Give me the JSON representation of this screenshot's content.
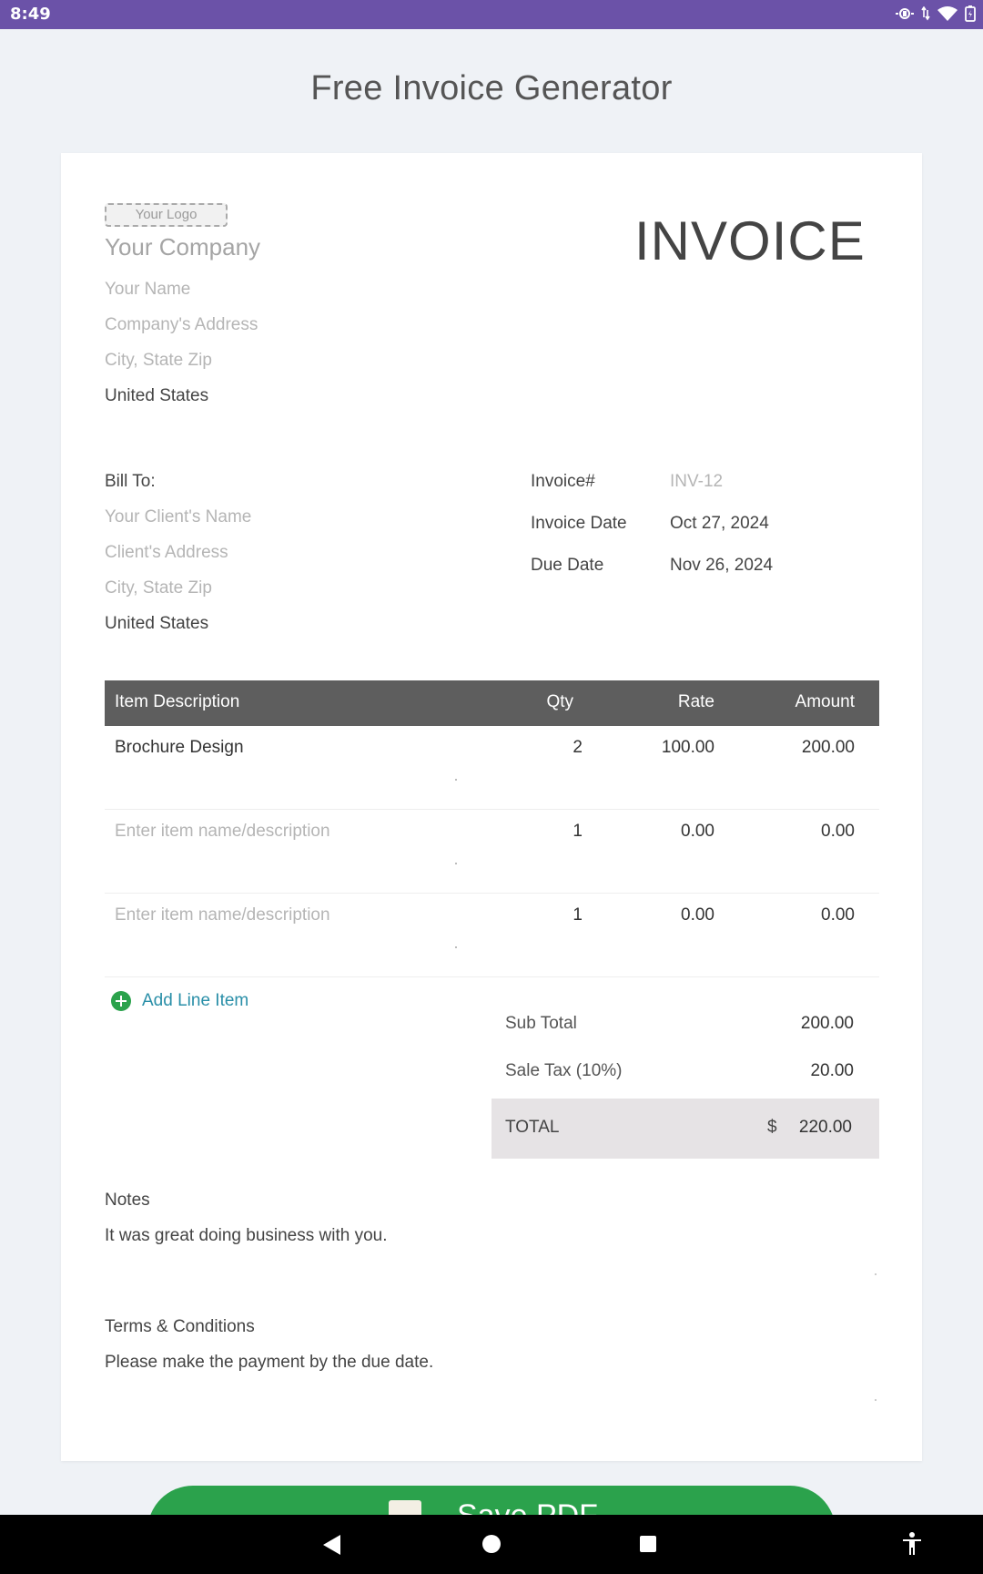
{
  "status_bar": {
    "time": "8:49"
  },
  "app": {
    "title": "Free Invoice Generator"
  },
  "invoice": {
    "logo_placeholder": "Your Logo",
    "heading": "INVOICE",
    "from": {
      "company_placeholder": "Your Company",
      "name_placeholder": "Your Name",
      "address_placeholder": "Company's Address",
      "city_placeholder": "City, State Zip",
      "country": "United States"
    },
    "bill_to": {
      "label": "Bill To:",
      "name_placeholder": "Your Client's Name",
      "address_placeholder": "Client's Address",
      "city_placeholder": "City, State Zip",
      "country": "United States"
    },
    "meta": {
      "number_label": "Invoice#",
      "number_placeholder": "INV-12",
      "date_label": "Invoice Date",
      "date_value": "Oct 27, 2024",
      "due_label": "Due Date",
      "due_value": "Nov 26, 2024"
    },
    "table": {
      "headers": {
        "description": "Item Description",
        "qty": "Qty",
        "rate": "Rate",
        "amount": "Amount"
      },
      "rows": [
        {
          "description": "Brochure Design",
          "qty": "2",
          "rate": "100.00",
          "amount": "200.00",
          "is_placeholder": false
        },
        {
          "description": "Enter item name/description",
          "qty": "1",
          "rate": "0.00",
          "amount": "0.00",
          "is_placeholder": true
        },
        {
          "description": "Enter item name/description",
          "qty": "1",
          "rate": "0.00",
          "amount": "0.00",
          "is_placeholder": true
        }
      ]
    },
    "add_line_label": "Add Line Item",
    "totals": {
      "subtotal_label": "Sub Total",
      "subtotal_value": "200.00",
      "tax_label": "Sale Tax (10%)",
      "tax_value": "20.00",
      "total_label": "TOTAL",
      "currency_symbol": "$",
      "total_value": "220.00"
    },
    "notes": {
      "label": "Notes",
      "text": "It was great doing business with you."
    },
    "terms": {
      "label": "Terms & Conditions",
      "text": "Please make the payment by the due date."
    }
  },
  "save_button": {
    "label": "Save PDF"
  },
  "colors": {
    "status_bar": "#6b52a8",
    "accent_green": "#2ba24c",
    "table_header": "#5e5e5e",
    "link": "#2a8fa8"
  },
  "icons": [
    "sync-icon",
    "data-transfer-icon",
    "wifi-icon",
    "battery-icon",
    "add-circle-icon",
    "pdf-file-icon",
    "back-icon",
    "home-icon",
    "recents-icon",
    "accessibility-icon"
  ]
}
